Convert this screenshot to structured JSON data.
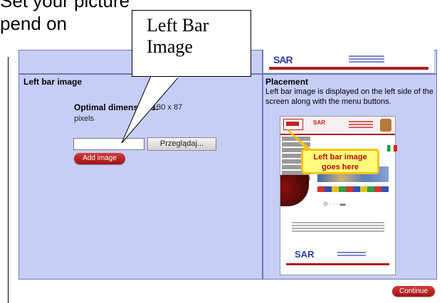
{
  "document": {
    "line1": "Set your picture",
    "line2": "pend on"
  },
  "annotation": {
    "line1": "Left Bar",
    "line2": "Image"
  },
  "left_section": {
    "title": "Left bar image",
    "optimal_label": "Optimal dimensions:",
    "optimal_value": "130 x 87",
    "optimal_unit": "pixels",
    "file_input_value": "",
    "browse_label": "Przeglądaj...",
    "add_label": "Add image"
  },
  "placement": {
    "title": "Placement",
    "description": "Left bar image is displayed on the left side of the screen along with the menu buttons."
  },
  "preview": {
    "logo_text": "SAR",
    "callout_line1": "Left bar image",
    "callout_line2": "goes here",
    "icons_text": "⊙   · · ·   ▬"
  },
  "top_strip": {
    "logo_text": "SAR"
  },
  "footer": {
    "continue_label": "Continue"
  },
  "colors": {
    "panel_bg": "#c6cef7",
    "panel_border": "#6e79b5",
    "button_red": "#b01c1c",
    "callout_fill": "#fffb7a",
    "callout_border": "#f3c316"
  }
}
